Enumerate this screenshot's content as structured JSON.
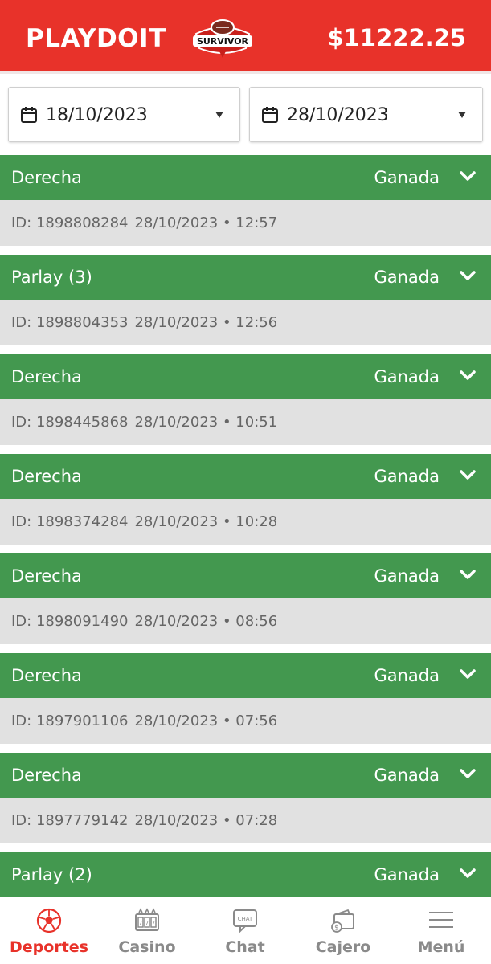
{
  "header": {
    "brand": "PLAYDOIT",
    "logo_text": "SURVIVOR",
    "balance": "$11222.25",
    "colors": {
      "background": "#e8322a",
      "text": "#ffffff"
    }
  },
  "filters": {
    "start_date": "18/10/2023",
    "end_date": "28/10/2023",
    "icons": {
      "calendar": "calendar-icon",
      "dropdown": "caret-down-icon"
    }
  },
  "bets": [
    {
      "type": "Derecha",
      "status": "Ganada",
      "id": "ID: 1898808284",
      "date": "28/10/2023",
      "time": "12:57"
    },
    {
      "type": "Parlay (3)",
      "status": "Ganada",
      "id": "ID: 1898804353",
      "date": "28/10/2023",
      "time": "12:56"
    },
    {
      "type": "Derecha",
      "status": "Ganada",
      "id": "ID: 1898445868",
      "date": "28/10/2023",
      "time": "10:51"
    },
    {
      "type": "Derecha",
      "status": "Ganada",
      "id": "ID: 1898374284",
      "date": "28/10/2023",
      "time": "10:28"
    },
    {
      "type": "Derecha",
      "status": "Ganada",
      "id": "ID: 1898091490",
      "date": "28/10/2023",
      "time": "08:56"
    },
    {
      "type": "Derecha",
      "status": "Ganada",
      "id": "ID: 1897901106",
      "date": "28/10/2023",
      "time": "07:56"
    },
    {
      "type": "Derecha",
      "status": "Ganada",
      "id": "ID: 1897779142",
      "date": "28/10/2023",
      "time": "07:28"
    },
    {
      "type": "Parlay (2)",
      "status": "Ganada",
      "id": "",
      "date": "",
      "time": ""
    }
  ],
  "bet_colors": {
    "header": "#43984f",
    "info": "#e1e1e1"
  },
  "nav": {
    "items": [
      {
        "label": "Deportes",
        "icon": "soccer-ball-icon",
        "active": true
      },
      {
        "label": "Casino",
        "icon": "slot-machine-icon",
        "active": false
      },
      {
        "label": "Chat",
        "icon": "chat-bubble-icon",
        "active": false,
        "icon_text": "CHAT"
      },
      {
        "label": "Cajero",
        "icon": "wallet-icon",
        "active": false
      },
      {
        "label": "Menú",
        "icon": "hamburger-menu-icon",
        "active": false
      }
    ],
    "active_color": "#e8322a",
    "inactive_color": "#8a8a8a"
  }
}
